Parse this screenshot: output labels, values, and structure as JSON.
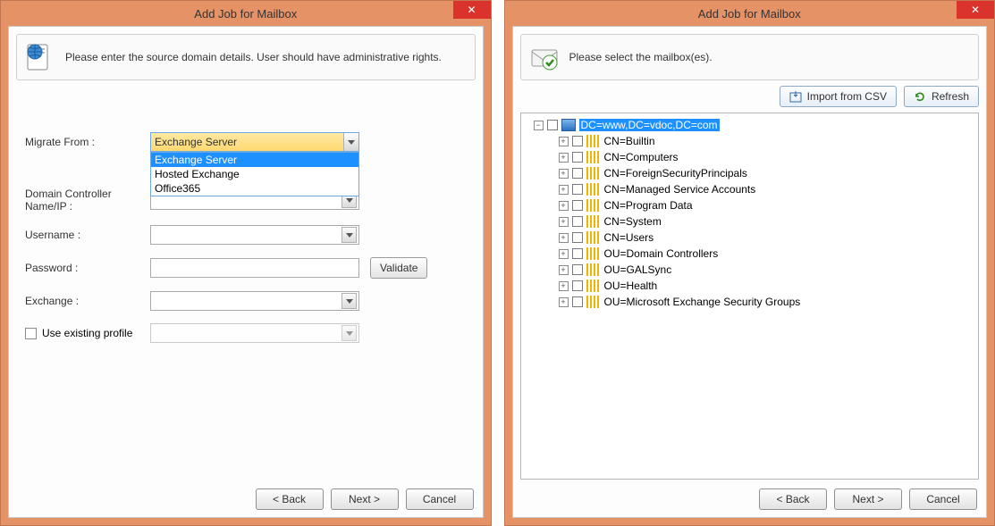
{
  "window1": {
    "title": "Add Job for Mailbox",
    "info": "Please enter the source domain details. User should have administrative rights.",
    "labels": {
      "migrate_from": "Migrate From :",
      "dc_name": "Domain Controller Name/IP :",
      "username": "Username :",
      "password": "Password :",
      "exchange": "Exchange :",
      "use_existing_profile": "Use existing profile"
    },
    "migrate_from_selected": "Exchange Server",
    "migrate_from_options": [
      "Exchange Server",
      "Hosted Exchange",
      "Office365"
    ],
    "validate_btn": "Validate",
    "nav": {
      "back": "< Back",
      "next": "Next >",
      "cancel": "Cancel"
    }
  },
  "window2": {
    "title": "Add Job for Mailbox",
    "info": "Please select the mailbox(es).",
    "toolbar": {
      "import_csv": "Import from CSV",
      "refresh": "Refresh"
    },
    "tree": {
      "root": "DC=www,DC=vdoc,DC=com",
      "children": [
        "CN=Builtin",
        "CN=Computers",
        "CN=ForeignSecurityPrincipals",
        "CN=Managed Service Accounts",
        "CN=Program Data",
        "CN=System",
        "CN=Users",
        "OU=Domain Controllers",
        "OU=GALSync",
        "OU=Health",
        "OU=Microsoft Exchange Security Groups"
      ]
    },
    "nav": {
      "back": "< Back",
      "next": "Next >",
      "cancel": "Cancel"
    }
  }
}
